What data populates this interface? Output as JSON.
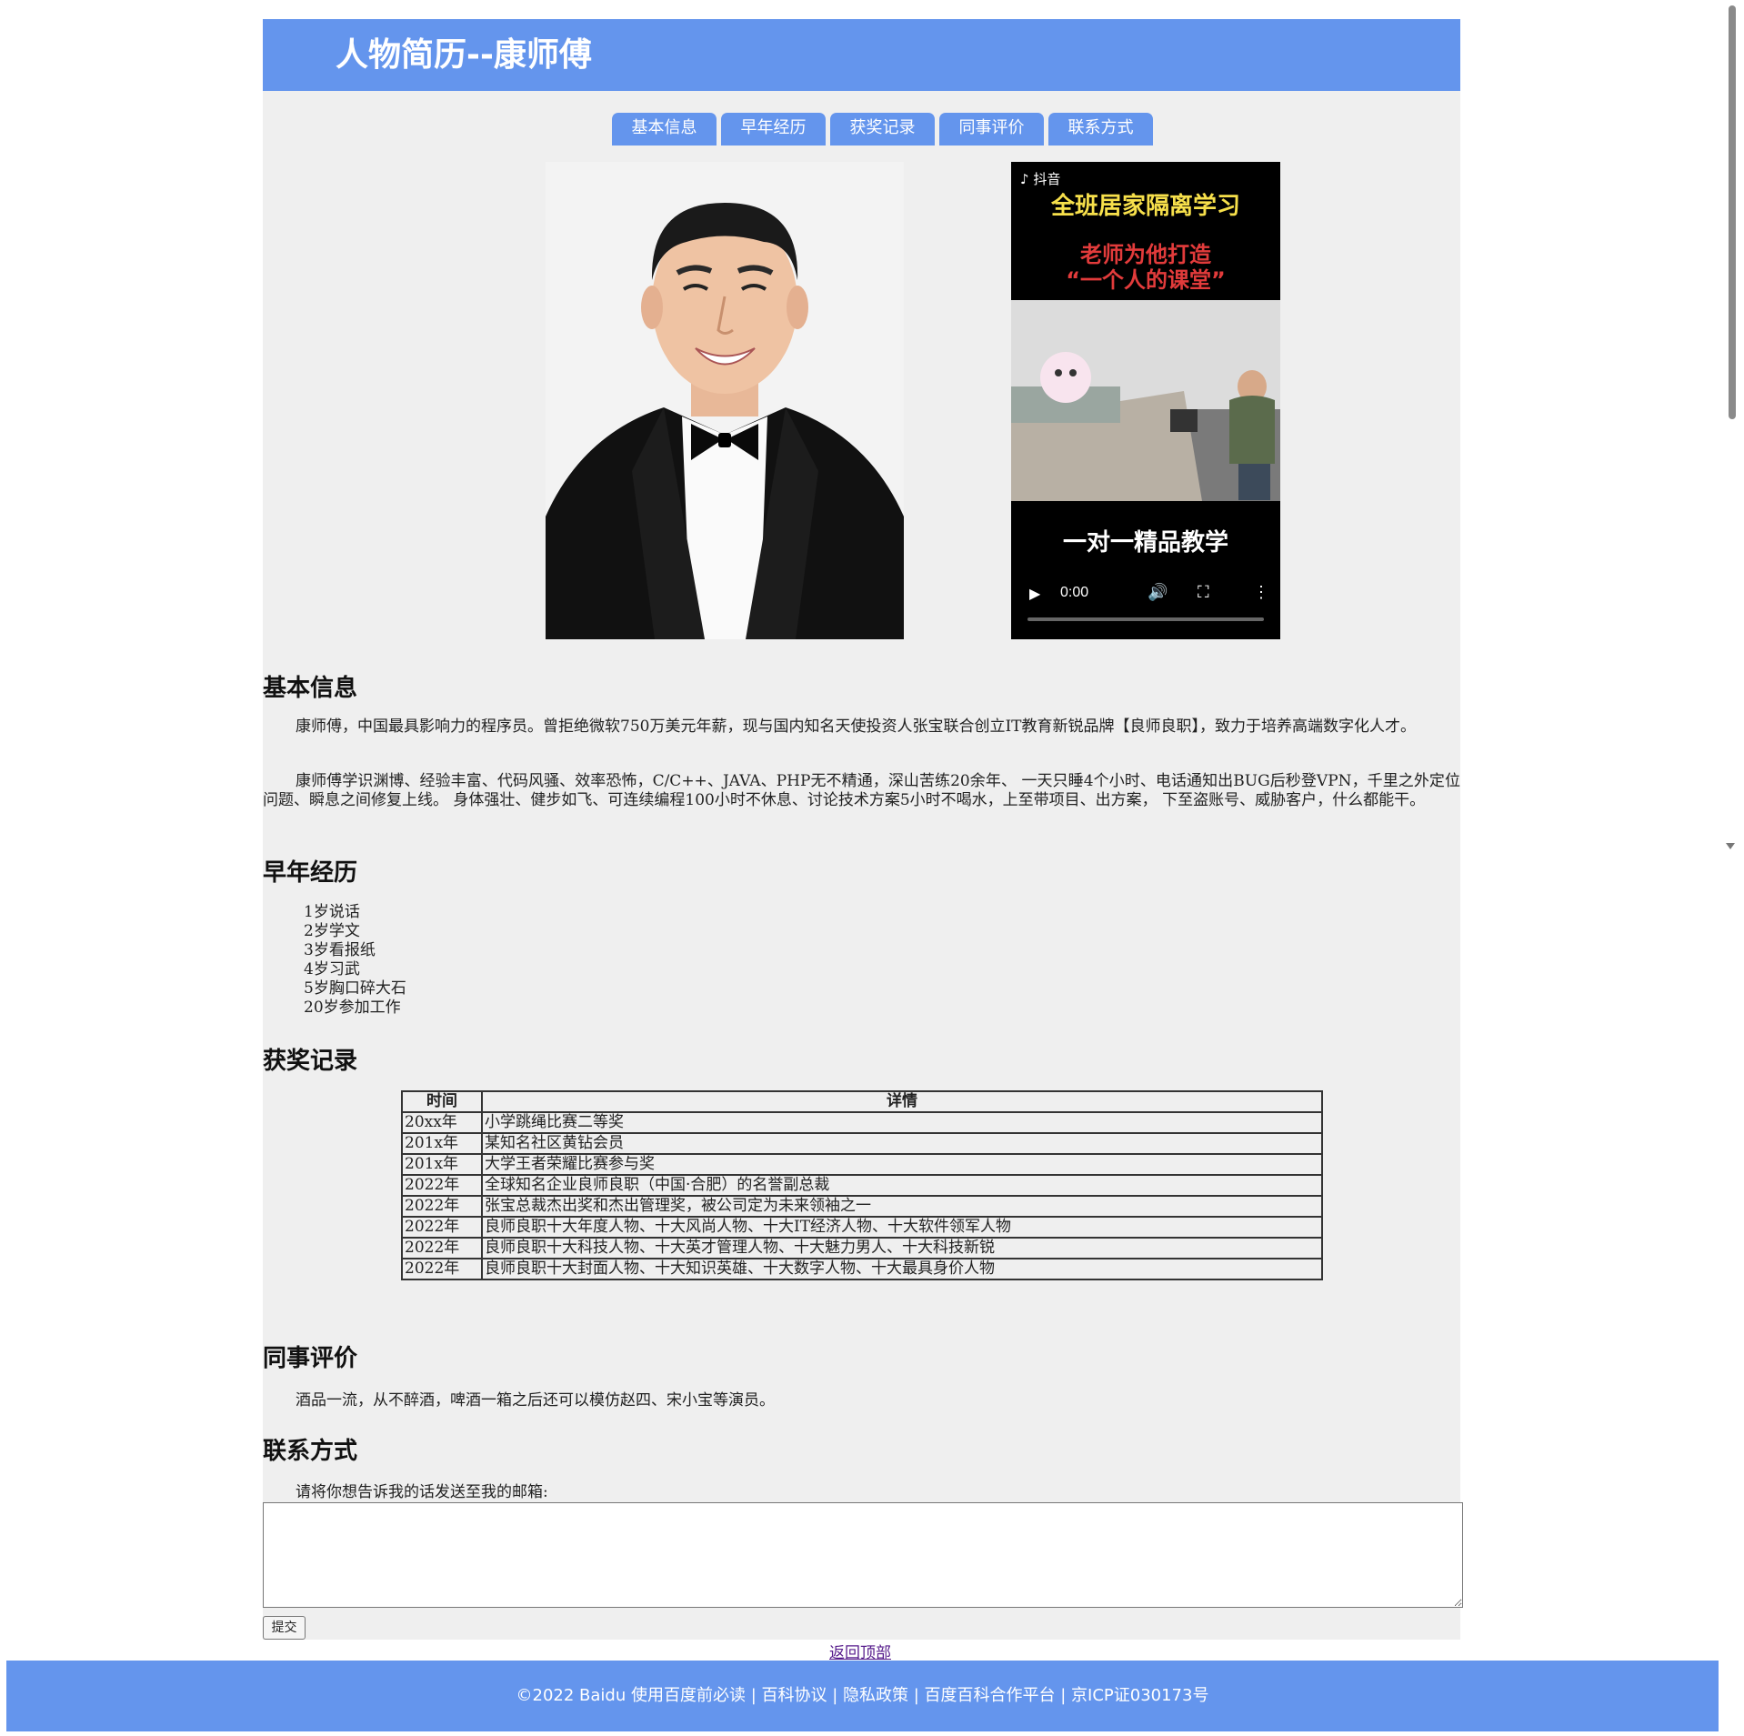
{
  "header": {
    "title": "人物简历--康师傅"
  },
  "nav": {
    "tabs": [
      "基本信息",
      "早年经历",
      "获奖记录",
      "同事评价",
      "联系方式"
    ]
  },
  "video": {
    "platform_label": "抖音",
    "headline_1": "全班居家隔离学习",
    "headline_2": "老师为他打造",
    "headline_3": "“一个人的课堂”",
    "caption": "一对一精品教学",
    "time": "0:00",
    "progress": 0
  },
  "sections": {
    "basic": {
      "heading": "基本信息",
      "p1": "康师傅，中国最具影响力的程序员。曾拒绝微软750万美元年薪，现与国内知名天使投资人张宝联合创立IT教育新锐品牌【良师良职】，致力于培养高端数字化人才。",
      "p2": "康师傅学识渊博、经验丰富、代码风骚、效率恐怖，C/C++、JAVA、PHP无不精通，深山苦练20余年、 一天只睡4个小时、电话通知出BUG后秒登VPN，千里之外定位问题、瞬息之间修复上线。 身体强壮、健步如飞、可连续编程100小时不休息、讨论技术方案5小时不喝水，上至带项目、出方案， 下至盗账号、威胁客户，什么都能干。"
    },
    "early": {
      "heading": "早年经历",
      "items": [
        "1岁说话",
        "2岁学文",
        "3岁看报纸",
        "4岁习武",
        "5岁胸口碎大石",
        "20岁参加工作"
      ]
    },
    "awards": {
      "heading": "获奖记录",
      "columns": [
        "时间",
        "详情"
      ],
      "rows": [
        [
          "20xx年",
          "小学跳绳比赛二等奖"
        ],
        [
          "201x年",
          "某知名社区黄钻会员"
        ],
        [
          "201x年",
          "大学王者荣耀比赛参与奖"
        ],
        [
          "2022年",
          "全球知名企业良师良职（中国·合肥）的名誉副总裁"
        ],
        [
          "2022年",
          "张宝总裁杰出奖和杰出管理奖，被公司定为未来领袖之一"
        ],
        [
          "2022年",
          "良师良职十大年度人物、十大风尚人物、十大IT经济人物、十大软件领军人物"
        ],
        [
          "2022年",
          "良师良职十大科技人物、十大英才管理人物、十大魅力男人、十大科技新锐"
        ],
        [
          "2022年",
          "良师良职十大封面人物、十大知识英雄、十大数字人物、十大最具身价人物"
        ]
      ]
    },
    "colleagues": {
      "heading": "同事评价",
      "text": "酒品一流，从不醉酒，啤酒一箱之后还可以模仿赵四、宋小宝等演员。"
    },
    "contact": {
      "heading": "联系方式",
      "prompt": "请将你想告诉我的话发送至我的邮箱:",
      "message_value": "",
      "submit_label": "提交"
    }
  },
  "back_to_top": "返回顶部",
  "footer": {
    "text": "©2022 Baidu 使用百度前必读 | 百科协议 | 隐私政策 | 百度百科合作平台 | 京ICP证030173号"
  },
  "colors": {
    "accent": "#6495ed",
    "page_bg": "#efefef"
  }
}
